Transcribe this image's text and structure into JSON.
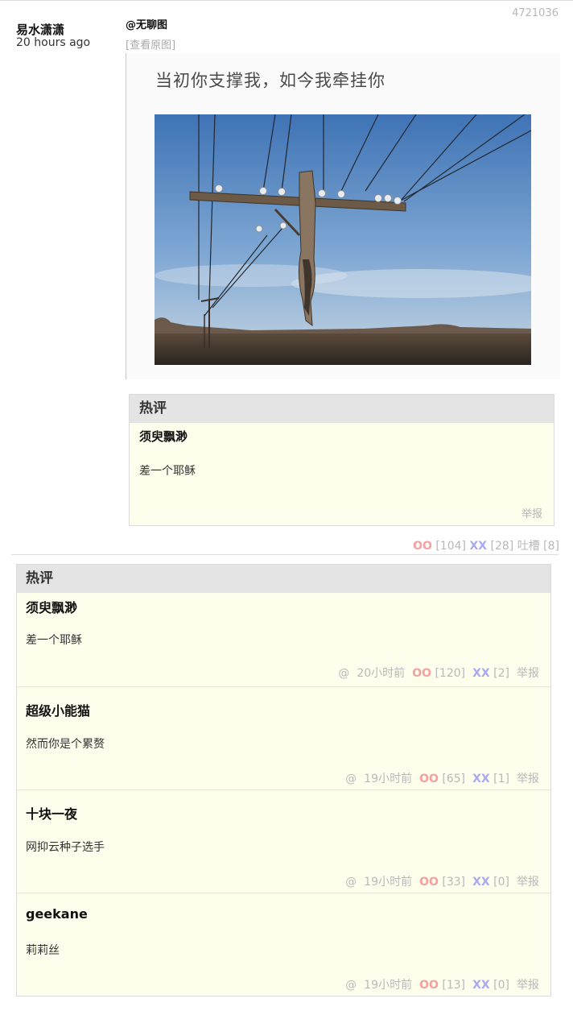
{
  "post": {
    "id": "4721036",
    "author": "易水潇潇",
    "time": "20 hours ago",
    "mention": "@无聊图",
    "view_original": "[查看原图]",
    "image_caption": "当初你支撑我，如今我牵挂你"
  },
  "inline_hot": {
    "header": "热评",
    "author": "须臾飘渺",
    "text": "差一个耶稣",
    "report": "举报"
  },
  "votes": {
    "oo_label": "OO",
    "oo_count": "[104]",
    "xx_label": "XX",
    "xx_count": "[28]",
    "tucao_label": "吐槽",
    "tucao_count": "[8]"
  },
  "hot_panel": {
    "header": "热评",
    "comments": [
      {
        "author": "须臾飘渺",
        "text": "差一个耶稣",
        "at": "@",
        "time": "20小时前",
        "oo": "OO",
        "oo_count": "[120]",
        "xx": "XX",
        "xx_count": "[2]",
        "report": "举报"
      },
      {
        "author": "超级小能猫",
        "text": "然而你是个累赘",
        "at": "@",
        "time": "19小时前",
        "oo": "OO",
        "oo_count": "[65]",
        "xx": "XX",
        "xx_count": "[1]",
        "report": "举报"
      },
      {
        "author": "十块一夜",
        "text": "网抑云种子选手",
        "at": "@",
        "time": "19小时前",
        "oo": "OO",
        "oo_count": "[33]",
        "xx": "XX",
        "xx_count": "[0]",
        "report": "举报"
      },
      {
        "author": "geekane",
        "text": "莉莉丝",
        "at": "@",
        "time": "19小时前",
        "oo": "OO",
        "oo_count": "[13]",
        "xx": "XX",
        "xx_count": "[0]",
        "report": "举报"
      }
    ]
  },
  "colors": {
    "oo": "#f4a0a0",
    "xx": "#a9a9f2",
    "comment_bg": "#fdfeec",
    "header_bg": "#e4e4e4"
  }
}
